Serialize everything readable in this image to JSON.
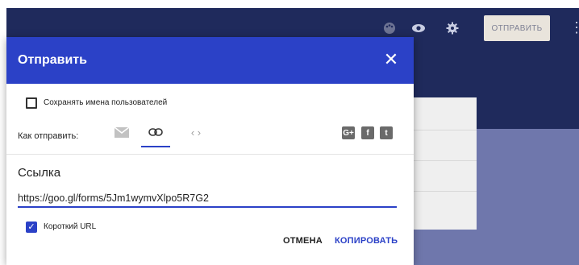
{
  "appbar": {
    "send_label": "ОТПРАВИТЬ",
    "icons": [
      "palette-icon",
      "eye-icon",
      "gear-icon",
      "more-vert-icon"
    ]
  },
  "dialog": {
    "title": "Отправить",
    "collect_names_label": "Сохранять имена пользователей",
    "collect_names_checked": false,
    "send_via_label": "Как отправить:",
    "methods": [
      "email-icon",
      "link-icon",
      "embed-icon"
    ],
    "active_method": "link-icon",
    "social": [
      {
        "name": "google-plus-icon",
        "glyph": "G+"
      },
      {
        "name": "facebook-icon",
        "glyph": "f"
      },
      {
        "name": "twitter-icon",
        "glyph": "t"
      }
    ],
    "link_section_title": "Ссылка",
    "link_value": "https://goo.gl/forms/5Jm1wymvXlpo5R7G2",
    "short_url_label": "Короткий URL",
    "short_url_checked": true,
    "cancel_label": "ОТМЕНА",
    "copy_label": "КОПИРОВАТЬ"
  },
  "colors": {
    "header": "#2b41c7",
    "appbar": "#1f2a5c",
    "accent": "#2b41c7"
  }
}
